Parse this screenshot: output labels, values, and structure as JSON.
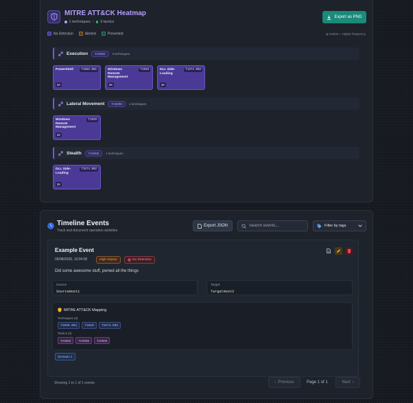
{
  "heatmap": {
    "title": "MITRE ATT&CK Heatmap",
    "techniques_count": "1 techniques",
    "tactics_count": "3 tactics",
    "export_label": "Export as PNG",
    "legend": {
      "no_detection": "No Detection",
      "alerted": "Alerted",
      "prevented": "Prevented",
      "hint": "Darker = Higher frequency"
    },
    "colors": {
      "accent": "#b79cff",
      "technique_card": "#4b3a95",
      "export_button": "#1a8a79"
    },
    "tactics": [
      {
        "name": "Execution",
        "id": "TA0002",
        "count": "3 techniques",
        "techniques": [
          {
            "name": "PowerShell",
            "id": "T1059.001",
            "count": "1×"
          },
          {
            "name": "Windows Remote Management",
            "id": "T1028",
            "count": "1×"
          },
          {
            "name": "DLL Side-Loading",
            "id": "T1574.002",
            "count": "1×"
          }
        ]
      },
      {
        "name": "Lateral Movement",
        "id": "TA0008",
        "count": "1 techniques",
        "techniques": [
          {
            "name": "Windows Remote Management",
            "id": "T1028",
            "count": "1×"
          }
        ]
      },
      {
        "name": "Stealth",
        "id": "TA0005",
        "count": "1 techniques",
        "techniques": [
          {
            "name": "DLL Side-Loading",
            "id": "T1574.002",
            "count": "1×"
          }
        ]
      }
    ]
  },
  "timeline": {
    "title": "Timeline Events",
    "subtitle": "Track and document operation activities",
    "export_json_label": "Export JSON",
    "search_placeholder": "Search events...",
    "filter_label": "Filter by tags",
    "event": {
      "title": "Example Event",
      "date": "05/08/2026, 10:04:00",
      "impact_badge": "High Impact",
      "detection_badge": "No Detection",
      "description": "Did some awesome stuff, pwned all the things",
      "source_label": "Source",
      "source_value": "SourceHost1",
      "target_label": "Target",
      "target_value": "TargetHost2",
      "mapping_title": "MITRE ATT&CK Mapping",
      "techniques_label": "Techniques (3)",
      "techniques": [
        "T1059.001",
        "T1028",
        "T1574.002"
      ],
      "tactics_label": "Tactics (3)",
      "tactics": [
        "TA0002",
        "TA0008",
        "TA0005"
      ],
      "scenario_tag": "Scenario 1"
    },
    "pagination": {
      "info": "Showing 1 to 1 of 1 events",
      "previous": "Previous",
      "page": "Page 1 of 1",
      "next": "Next"
    }
  }
}
